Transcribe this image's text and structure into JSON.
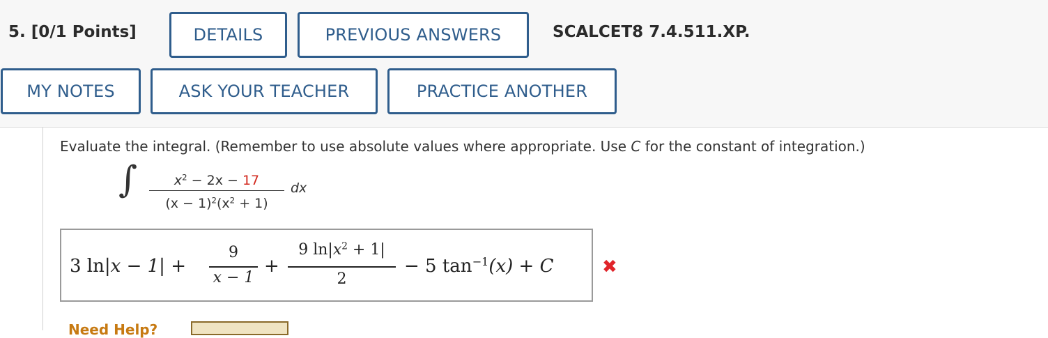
{
  "question": {
    "number_label": "5.",
    "points_label": "[0/1 Points]",
    "code": "SCALCET8 7.4.511.XP."
  },
  "buttons": {
    "details": "DETAILS",
    "previous_answers": "PREVIOUS ANSWERS",
    "my_notes": "MY NOTES",
    "ask_teacher": "ASK YOUR TEACHER",
    "practice_another": "PRACTICE ANOTHER"
  },
  "prompt": {
    "text_before": "Evaluate the integral. (Remember to use absolute values where appropriate. Use ",
    "variable": "C",
    "text_after": " for the constant of integration.)"
  },
  "integral": {
    "sign": "∫",
    "numerator_x": "x",
    "numerator_exp": "2",
    "numerator_middle": " − 2x − ",
    "numerator_const": "17",
    "denominator_a": "(x − 1)",
    "denominator_exp1": "2",
    "denominator_b": "(x",
    "denominator_exp2": "2",
    "denominator_c": " + 1)",
    "differential": "dx"
  },
  "answer": {
    "term1_coef": "3 ln",
    "term1_arg": "x − 1",
    "plus1": "+",
    "frac1_num": "9",
    "frac1_den": "x − 1",
    "plus2": "+",
    "frac2_num_prefix": "9 ln",
    "frac2_num_arg": "x",
    "frac2_num_exp": "2",
    "frac2_num_suffix": " + 1",
    "frac2_den": "2",
    "minus": "− 5 tan",
    "tan_exp": "−1",
    "tan_arg": "(x) + C",
    "status": "incorrect"
  },
  "colors": {
    "button_border": "#2f5d8c",
    "highlight_red": "#d2281e",
    "wrong_mark": "#e0242a"
  },
  "icons": {
    "status_icon": "cross-icon",
    "status_glyph": "✖"
  },
  "help": {
    "label": "Need Help?"
  }
}
